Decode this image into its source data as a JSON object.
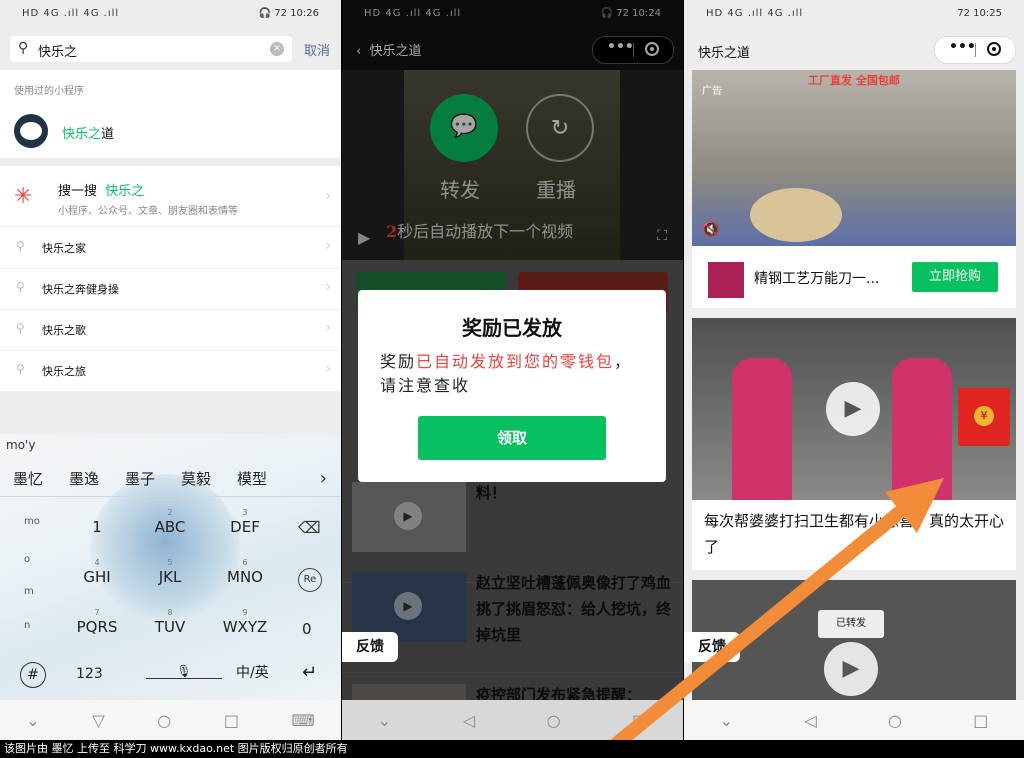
{
  "panel1": {
    "status_left": "HD 4G .ıll 4G .ıll",
    "status_right": "🎧 72 10:26",
    "search": {
      "value": "快乐之",
      "cancel": "取消"
    },
    "used_title": "使用过的小程序",
    "used_item": {
      "prefix": "快乐之",
      "suffix": "道"
    },
    "souyisou": {
      "label": "搜一搜",
      "keyword": "快乐之",
      "desc": "小程序、公众号、文章、朋友圈和表情等"
    },
    "suggestions": [
      "快乐之家",
      "快乐之奔健身操",
      "快乐之歌",
      "快乐之旅"
    ],
    "keyboard": {
      "pinyin": "mo'y",
      "candidates": [
        "墨忆",
        "墨逸",
        "墨子",
        "莫毅",
        "模型"
      ],
      "keys": [
        {
          "num": "",
          "label": "1"
        },
        {
          "num": "2",
          "label": "ABC"
        },
        {
          "num": "3",
          "label": "DEF"
        },
        {
          "num": "4",
          "label": "GHI"
        },
        {
          "num": "5",
          "label": "JKL"
        },
        {
          "num": "6",
          "label": "MNO"
        },
        {
          "num": "7",
          "label": "PQRS"
        },
        {
          "num": "8",
          "label": "TUV"
        },
        {
          "num": "9",
          "label": "WXYZ"
        }
      ],
      "side": [
        "mo",
        "o",
        "m",
        "n"
      ],
      "zero": "0",
      "hash": "#",
      "num_key": "123",
      "lang": "中/英",
      "re": "Re"
    }
  },
  "panel2": {
    "status_left": "HD 4G .ıll 4G .ıll",
    "status_right": "🎧 72 10:24",
    "title": "快乐之道",
    "share": "转发",
    "replay": "重播",
    "countdown": "2",
    "autoplay_text": "秒后自动播放下一个视频",
    "modal": {
      "title": "奖励已发放",
      "body_prefix": "奖励",
      "body_red": "已自动发放到您的零钱包",
      "body_suffix": "，请注意查收",
      "button": "领取"
    },
    "articles": [
      {
        "title": "料！"
      },
      {
        "title": "赵立坚吐槽蓬佩奥像打了鸡血 挑了挑眉怒怼：给人挖坑，终掉坑里"
      },
      {
        "title": "疫控部门发布紧急提醒："
      }
    ],
    "feedback": "反馈"
  },
  "panel3": {
    "status_left": "HD 4G .ıll 4G .ıll",
    "status_right": "72 10:25",
    "title": "快乐之道",
    "ad": {
      "caption": "工厂直发 全国包邮",
      "tag": "广告",
      "product": "精钢工艺万能刀一...",
      "buy": "立即抢购"
    },
    "post_title": "每次帮婆婆打扫卫生都有小惊喜，真的太开心了",
    "shared_badge": "已转发",
    "feedback": "反馈"
  },
  "footer": "该图片由 墨忆 上传至 科学刀 www.kxdao.net 图片版权归原创者所有",
  "colors": {
    "wechat_green": "#07c160",
    "red": "#e64340",
    "arrow_orange": "#f28c38"
  }
}
